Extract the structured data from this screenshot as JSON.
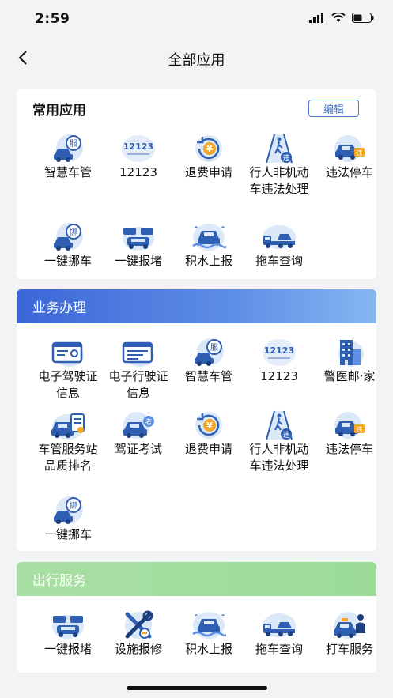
{
  "status_bar": {
    "time": "2:59"
  },
  "nav": {
    "title": "全部应用"
  },
  "common": {
    "title": "常用应用",
    "edit_label": "编辑",
    "items": [
      {
        "label": "智慧车管",
        "icon": "car-service-icon"
      },
      {
        "label": "12123",
        "icon": "app-12123-icon"
      },
      {
        "label": "退费申请",
        "icon": "refund-icon"
      },
      {
        "label": "行人非机动车违法处理",
        "icon": "pedestrian-violation-icon"
      },
      {
        "label": "违法停车",
        "icon": "illegal-parking-icon"
      },
      {
        "label": "一键挪车",
        "icon": "move-car-icon"
      },
      {
        "label": "一键报堵",
        "icon": "report-congestion-icon"
      },
      {
        "label": "积水上报",
        "icon": "water-report-icon"
      },
      {
        "label": "拖车查询",
        "icon": "tow-truck-icon"
      }
    ]
  },
  "business": {
    "title": "业务办理",
    "items": [
      {
        "label": "电子驾驶证信息",
        "icon": "driver-license-icon"
      },
      {
        "label": "电子行驶证信息",
        "icon": "vehicle-license-icon"
      },
      {
        "label": "智慧车管",
        "icon": "car-service-icon"
      },
      {
        "label": "12123",
        "icon": "app-12123-icon"
      },
      {
        "label": "警医邮·家",
        "icon": "building-icon"
      },
      {
        "label": "车管服务站品质排名",
        "icon": "station-ranking-icon"
      },
      {
        "label": "驾证考试",
        "icon": "driving-exam-icon"
      },
      {
        "label": "退费申请",
        "icon": "refund-icon"
      },
      {
        "label": "行人非机动车违法处理",
        "icon": "pedestrian-violation-icon"
      },
      {
        "label": "违法停车",
        "icon": "illegal-parking-icon"
      },
      {
        "label": "一键挪车",
        "icon": "move-car-icon"
      }
    ]
  },
  "travel": {
    "title": "出行服务",
    "items": [
      {
        "label": "一键报堵",
        "icon": "report-congestion-icon"
      },
      {
        "label": "设施报修",
        "icon": "repair-tools-icon"
      },
      {
        "label": "积水上报",
        "icon": "water-report-icon"
      },
      {
        "label": "拖车查询",
        "icon": "tow-truck-icon"
      },
      {
        "label": "打车服务",
        "icon": "taxi-service-icon"
      }
    ]
  },
  "colors": {
    "accent": "#3c66d8",
    "icon_blue": "#2f5fb3",
    "icon_bg": "#dbe8f8",
    "badge_orange": "#f5a623"
  }
}
